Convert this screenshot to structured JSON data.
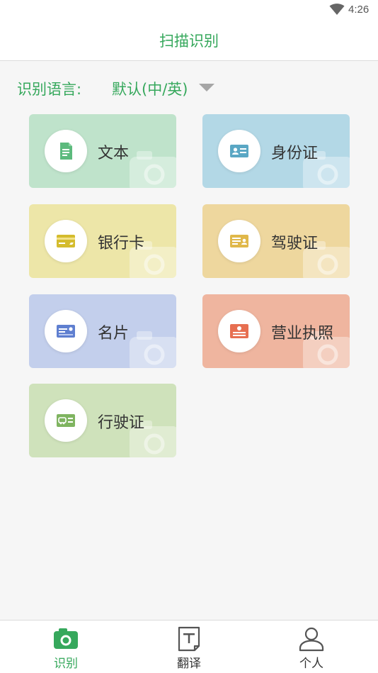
{
  "status_bar": {
    "time": "4:26",
    "wifi_icon": "wifi-icon"
  },
  "header": {
    "title": "扫描识别"
  },
  "language": {
    "label": "识别语言:",
    "value": "默认(中/英)",
    "caret_icon": "dropdown-caret-icon"
  },
  "cards": [
    {
      "label": "文本",
      "icon": "document-icon",
      "color": "#bfe3cb"
    },
    {
      "label": "身份证",
      "icon": "id-card-icon",
      "color": "#b3d8e6"
    },
    {
      "label": "银行卡",
      "icon": "bank-card-icon",
      "color": "#ede6a8"
    },
    {
      "label": "驾驶证",
      "icon": "driver-license-icon",
      "color": "#eed79e"
    },
    {
      "label": "名片",
      "icon": "business-card-icon",
      "color": "#c3cfec"
    },
    {
      "label": "营业执照",
      "icon": "business-license-icon",
      "color": "#efb59f"
    },
    {
      "label": "行驶证",
      "icon": "vehicle-license-icon",
      "color": "#cfe2bb"
    }
  ],
  "bottom_nav": [
    {
      "label": "识别",
      "icon": "camera-icon",
      "active": true
    },
    {
      "label": "翻译",
      "icon": "translate-icon",
      "active": false
    },
    {
      "label": "个人",
      "icon": "person-icon",
      "active": false
    }
  ],
  "colors": {
    "accent": "#36a85c",
    "background": "#f6f6f6"
  }
}
